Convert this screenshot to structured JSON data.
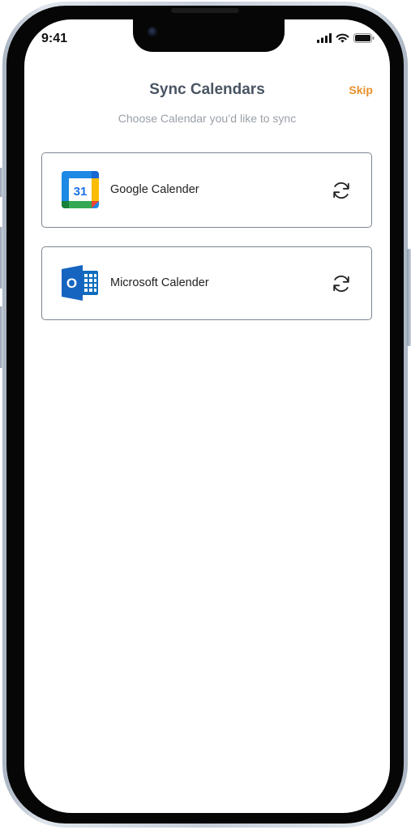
{
  "status_bar": {
    "time": "9:41",
    "icons": [
      "cellular-signal-icon",
      "wifi-icon",
      "battery-icon"
    ]
  },
  "header": {
    "title": "Sync Calendars",
    "skip_label": "Skip"
  },
  "subtitle": "Choose Calendar you’d like to sync",
  "calendars": [
    {
      "label": "Google Calender",
      "logo": "google-calendar-logo",
      "logo_text": "31",
      "action_icon": "sync-icon"
    },
    {
      "label": "Microsoft Calender",
      "logo": "outlook-logo",
      "logo_text": "O",
      "action_icon": "sync-icon"
    }
  ],
  "colors": {
    "accent": "#e8902a",
    "title": "#4a5563",
    "subtitle": "#9aa0a7",
    "card_border": "#7d8590"
  }
}
